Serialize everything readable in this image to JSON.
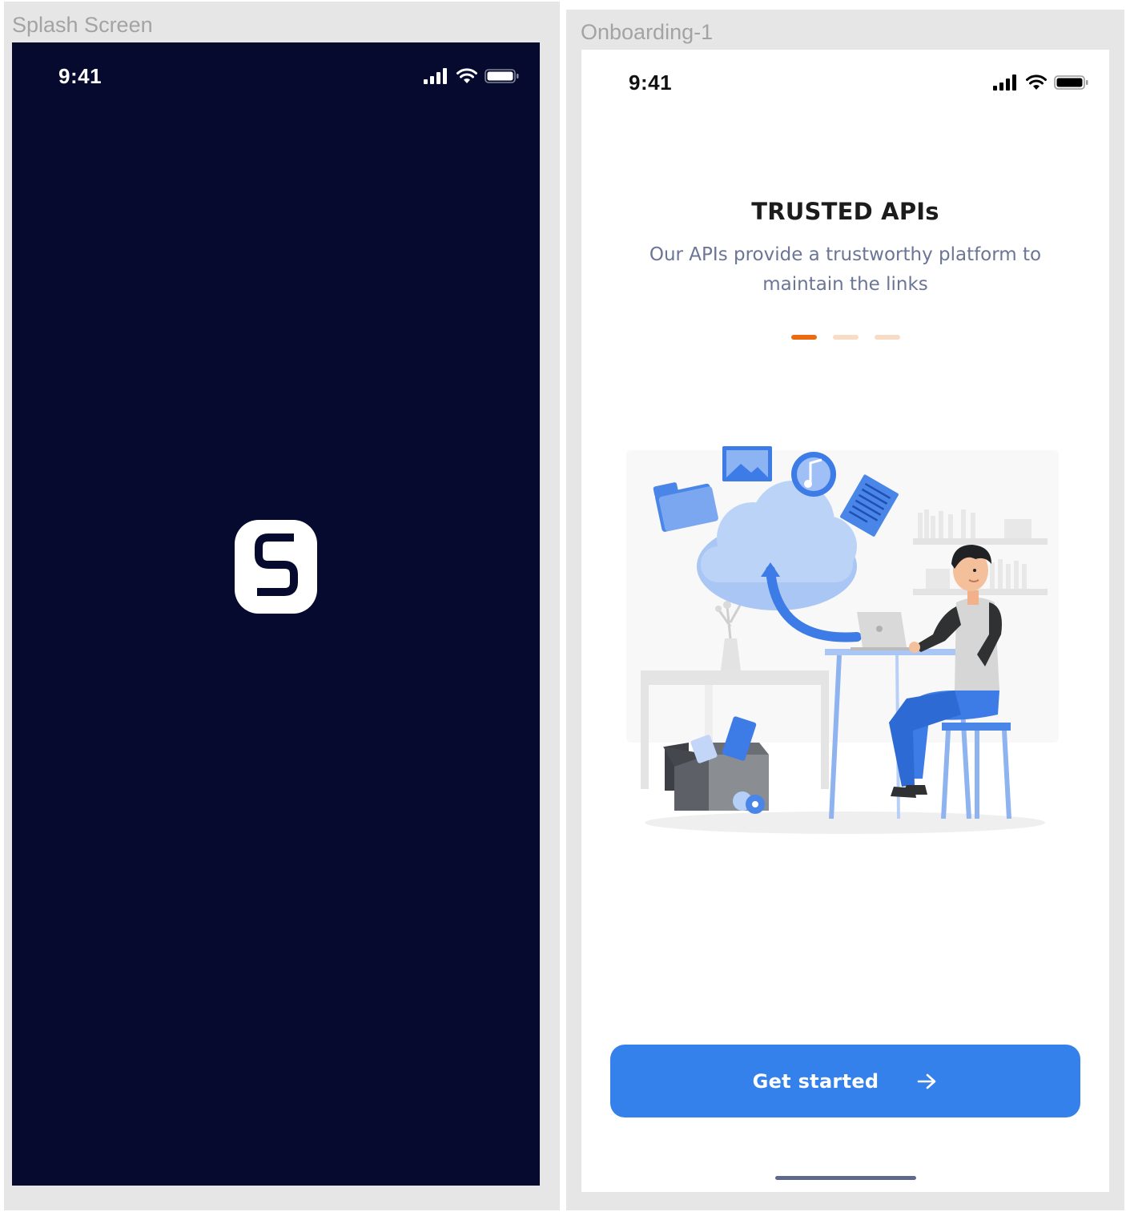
{
  "splash": {
    "frame_label": "Splash Screen",
    "status_time": "9:41",
    "logo_glyph": "S",
    "bg_color": "#050a2e"
  },
  "onboarding": {
    "frame_label": "Onboarding-1",
    "status_time": "9:41",
    "title": "TRUSTED APIs",
    "subtitle": "Our APIs provide a trustworthy platform to maintain the links",
    "pager": {
      "total": 3,
      "active": 1,
      "active_color": "#ec6a12",
      "inactive_color": "#f9dcc6"
    },
    "cta_label": "Get started",
    "cta_color": "#3581ec",
    "illustration": "person-at-laptop-uploading-to-cloud"
  }
}
